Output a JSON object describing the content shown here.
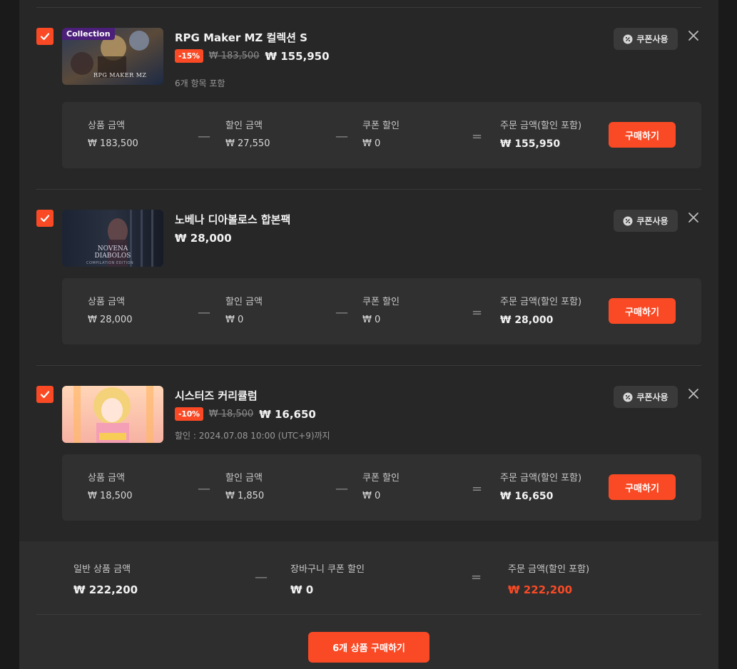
{
  "items": [
    {
      "title": "RPG Maker MZ 컬렉션 S",
      "discount": "-15%",
      "original_price": "₩ 183,500",
      "final_price": "₩ 155,950",
      "sub_text": "6개 항목 포함",
      "thumb_badge": "Collection",
      "thumb_logo": "RPG MAKER MZ",
      "coupon_label": "쿠폰사용",
      "summary": {
        "product_label": "상품 금액",
        "product_value": "₩ 183,500",
        "discount_label": "할인 금액",
        "discount_value": "₩ 27,550",
        "coupon_label": "쿠폰 할인",
        "coupon_value": "₩ 0",
        "order_label": "주문 금액(할인 포함)",
        "order_value": "₩ 155,950",
        "buy_label": "구매하기"
      }
    },
    {
      "title": "노베나 디아볼로스 합본팩",
      "final_price": "₩ 28,000",
      "thumb_logo": "NOVENA DIABOLOS",
      "thumb_sub": "COMPILATION EDITION",
      "coupon_label": "쿠폰사용",
      "summary": {
        "product_label": "상품 금액",
        "product_value": "₩ 28,000",
        "discount_label": "할인 금액",
        "discount_value": "₩ 0",
        "coupon_label": "쿠폰 할인",
        "coupon_value": "₩ 0",
        "order_label": "주문 금액(할인 포함)",
        "order_value": "₩ 28,000",
        "buy_label": "구매하기"
      }
    },
    {
      "title": "시스터즈 커리큘럼",
      "discount": "-10%",
      "original_price": "₩ 18,500",
      "final_price": "₩ 16,650",
      "sub_text": "할인 : 2024.07.08 10:00 (UTC+9)까지",
      "coupon_label": "쿠폰사용",
      "summary": {
        "product_label": "상품 금액",
        "product_value": "₩ 18,500",
        "discount_label": "할인 금액",
        "discount_value": "₩ 1,850",
        "coupon_label": "쿠폰 할인",
        "coupon_value": "₩ 0",
        "order_label": "주문 금액(할인 포함)",
        "order_value": "₩ 16,650",
        "buy_label": "구매하기"
      }
    }
  ],
  "totals": {
    "general_label": "일반 상품 금액",
    "general_value": "₩ 222,200",
    "cart_coupon_label": "장바구니 쿠폰 할인",
    "cart_coupon_value": "₩ 0",
    "order_label": "주문 금액(할인 포함)",
    "order_value": "₩ 222,200",
    "checkout_label": "6개 상품 구매하기"
  },
  "colors": {
    "accent": "#fa4a25",
    "panel": "#272727",
    "summary_box": "#303030"
  }
}
